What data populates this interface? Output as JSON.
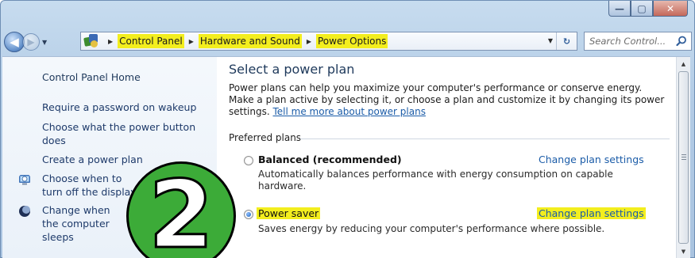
{
  "window": {
    "minimize_glyph": "—",
    "maximize_glyph": "▢",
    "close_glyph": "✕"
  },
  "nav": {
    "back_icon": "back-arrow-icon",
    "forward_icon": "forward-arrow-icon",
    "breadcrumbs": [
      "Control Panel",
      "Hardware and Sound",
      "Power Options"
    ],
    "refresh_glyph": "↻"
  },
  "search": {
    "placeholder": "Search Control..."
  },
  "sidebar": {
    "items": [
      {
        "label": "Control Panel Home"
      },
      {
        "label": "Require a password on wakeup"
      },
      {
        "label": "Choose what the power button does"
      },
      {
        "label": "Create a power plan"
      },
      {
        "label": "Choose when to turn off the display"
      },
      {
        "label": "Change when the computer sleeps"
      }
    ]
  },
  "main": {
    "title": "Select a power plan",
    "intro": "Power plans can help you maximize your computer's performance or conserve energy. Make a plan active by selecting it, or choose a plan and customize it by changing its power settings.",
    "intro_link": "Tell me more about power plans",
    "group_label": "Preferred plans",
    "plans": [
      {
        "name": "Balanced (recommended)",
        "selected": false,
        "link": "Change plan settings",
        "description": "Automatically balances performance with energy consumption on capable hardware."
      },
      {
        "name": "Power saver",
        "selected": true,
        "link": "Change plan settings",
        "description": "Saves energy by reducing your computer's performance where possible."
      }
    ]
  },
  "badge": {
    "number": "2"
  },
  "colors": {
    "highlight": "#f3ee1e",
    "link": "#1b5ca8",
    "badge_green": "#3cab38"
  }
}
